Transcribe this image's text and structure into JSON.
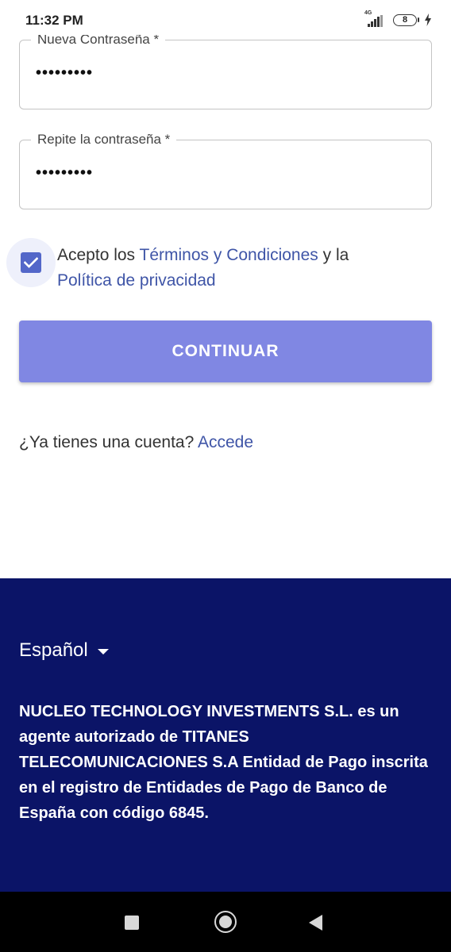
{
  "status_bar": {
    "time": "11:32 PM",
    "network": "4G",
    "battery": "8"
  },
  "form": {
    "new_password": {
      "label": "Nueva Contraseña *",
      "value": "•••••••••"
    },
    "repeat_password": {
      "label": "Repite la contraseña *",
      "value": "•••••••••"
    },
    "terms": {
      "checked": true,
      "prefix": "Acepto los ",
      "terms_link": "Términos y Condiciones",
      "middle": " y la",
      "privacy_link": "Política de privacidad"
    },
    "continue_label": "CONTINUAR",
    "account_prompt": "¿Ya tienes una cuenta? ",
    "login_link": "Accede"
  },
  "footer": {
    "language": "Español",
    "legal_text": "NUCLEO TECHNOLOGY INVESTMENTS S.L. es un agente autorizado de TITANES TELECOMUNICACIONES S.A Entidad de Pago inscrita en el registro de Entidades de Pago de Banco de España con código 6845."
  },
  "colors": {
    "accent": "#8087e3",
    "link": "#3f55a7",
    "checkbox": "#5367c9",
    "footer_bg": "#0b1467"
  },
  "icons": [
    "signal-icon",
    "battery-icon",
    "charging-icon",
    "checkbox-checked-icon",
    "dropdown-caret-icon",
    "recents-icon",
    "home-icon",
    "back-icon"
  ]
}
